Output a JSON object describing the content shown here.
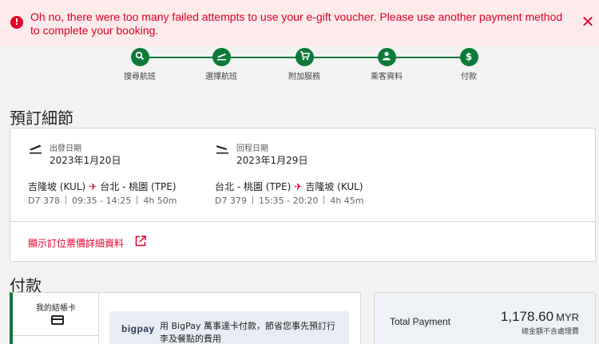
{
  "alert": {
    "message": "Oh no, there were too many failed attempts to use your e-gift voucher. Please use another payment method to complete your booking.",
    "icon": "error-icon",
    "close_icon": "close-icon",
    "color": "#e4002b",
    "background": "#fdeaea"
  },
  "steps": [
    {
      "label": "搜尋航班",
      "icon": "search-icon"
    },
    {
      "label": "選擇航班",
      "icon": "plane-takeoff-icon"
    },
    {
      "label": "附加服務",
      "icon": "cart-icon"
    },
    {
      "label": "乘客資料",
      "icon": "person-icon"
    },
    {
      "label": "付款",
      "icon": "dollar-icon"
    }
  ],
  "booking": {
    "title": "預訂細節",
    "outbound": {
      "date_label": "出發日期",
      "date": "2023年1月20日",
      "origin": "吉隆坡 (KUL)",
      "destination": "台北 - 桃園 (TPE)",
      "flight": "D7 378",
      "time": "09:35 - 14:25",
      "duration": "4h 50m"
    },
    "return": {
      "date_label": "回程日期",
      "date": "2023年1月29日",
      "origin": "台北 - 桃園 (TPE)",
      "destination": "吉隆坡 (KUL)",
      "flight": "D7 379",
      "time": "15:35 - 20:20",
      "duration": "4h 45m"
    },
    "details_link": "顯示訂位票價詳細資料"
  },
  "payment": {
    "title": "付款",
    "tab_label": "我的結帳卡",
    "bigpay_logo": "bigpay",
    "bigpay_text": "用 BigPay 萬事達卡付款，節省您事先預訂行李及餐點的費用",
    "total_label": "Total Payment",
    "total_amount": "1,178.60",
    "currency": "MYR",
    "total_note": "總金額不含處理費"
  },
  "colors": {
    "accent_green": "#0e7a3a",
    "brand_red": "#e4002b"
  }
}
